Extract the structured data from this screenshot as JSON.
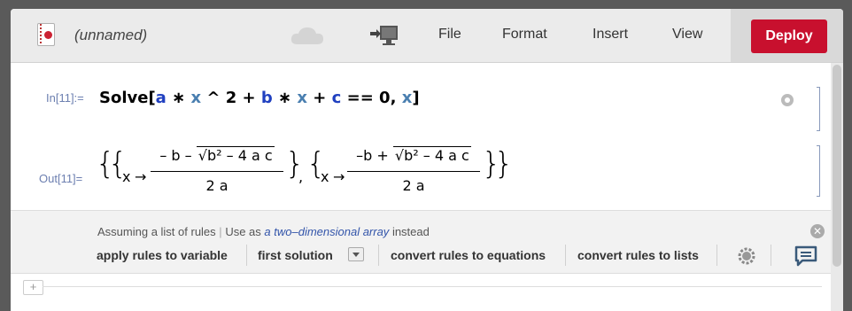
{
  "toolbar": {
    "title": "(unnamed)",
    "menu": [
      "File",
      "Format",
      "Insert",
      "View"
    ],
    "deploy_label": "Deploy",
    "accent": "#c8102e"
  },
  "cell": {
    "in_label": "In[11]:=",
    "out_label": "Out[11]=",
    "input_tokens": {
      "fn": "Solve[",
      "a": "a",
      "x1": "x",
      "pow": "^ 2 +",
      "b": "b",
      "x2": "x",
      "plus": "+",
      "c": "c",
      "eq": "== 0,",
      "x3": "x",
      "close": "]"
    },
    "output": {
      "sol1": {
        "var": "x",
        "arrow": "→",
        "num_prefix": "– b –",
        "radicand": "b² – 4 a c",
        "den": "2 a"
      },
      "sol2": {
        "var": "x",
        "arrow": "→",
        "num_prefix": "–b +",
        "radicand": "b² – 4 a c",
        "den": "2 a"
      },
      "comma": ","
    }
  },
  "assistant": {
    "assuming": "Assuming a list of rules",
    "use_as": "Use as",
    "alt_link": "a two–dimensional array",
    "instead": "instead",
    "actions": [
      "apply rules to variable",
      "first solution",
      "convert rules to equations",
      "convert rules to lists"
    ]
  },
  "icons": [
    "document-icon",
    "cloud-icon",
    "present-icon",
    "gear-icon",
    "close-icon",
    "chat-icon",
    "plus-icon"
  ]
}
